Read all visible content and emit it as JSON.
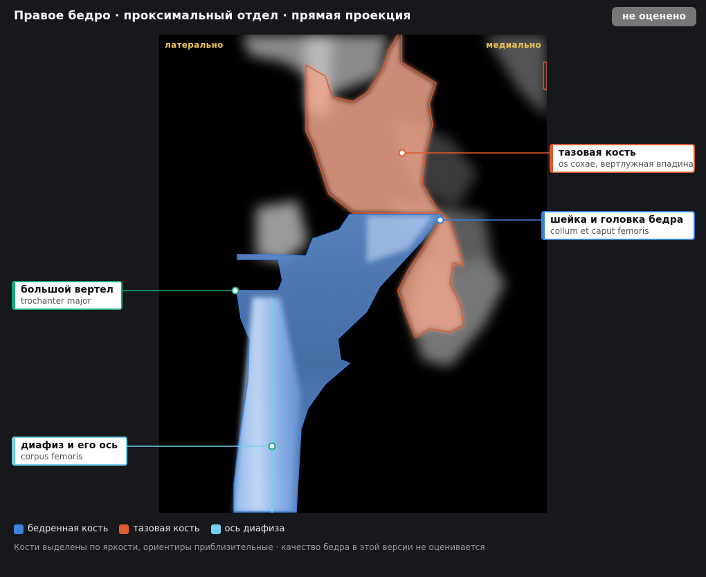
{
  "header": {
    "title": "Правое бедро · проксимальный отдел · прямая проекция",
    "status_badge": "не оценено"
  },
  "image": {
    "orientation_left": "латерально",
    "orientation_right": "медиально"
  },
  "labels": [
    {
      "id": "pelvis",
      "main": "тазовая кость",
      "sub": "os coxae, вертлужная впадина",
      "color": "#e05a2b"
    },
    {
      "id": "neck",
      "main": "шейка и головка бедра",
      "sub": "collum et caput femoris",
      "color": "#3b7fd8"
    },
    {
      "id": "trochanter",
      "main": "большой вертел",
      "sub": "trochanter major",
      "color": "#19a87a"
    },
    {
      "id": "shaft",
      "main": "диафиз и его ось",
      "sub": "corpus femoris",
      "color": "#74cfee"
    }
  ],
  "legend": [
    {
      "label": "бедренная кость",
      "color": "#3b82e0"
    },
    {
      "label": "тазовая кость",
      "color": "#e05a2b"
    },
    {
      "label": "ось диафиза",
      "color": "#74d0f2"
    }
  ],
  "footer_note": "Кости выделены по яркости, ориентиры приблизительные · качество бедра в этой версии не оценивается"
}
